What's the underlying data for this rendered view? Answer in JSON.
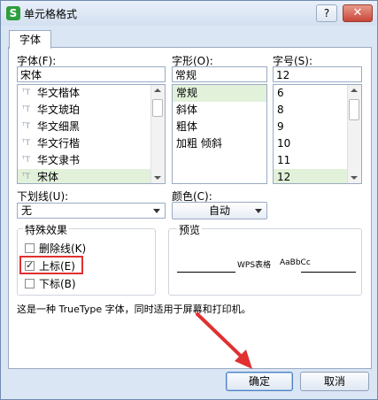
{
  "window": {
    "title": "单元格格式",
    "app_icon": "S",
    "help": "?",
    "close": "✕"
  },
  "tabs": [
    "字体"
  ],
  "font": {
    "label": "字体(F):",
    "value": "宋体",
    "items": [
      "华文楷体",
      "华文琥珀",
      "华文细黑",
      "华文行楷",
      "华文隶书",
      "宋体"
    ],
    "selected": "宋体"
  },
  "style": {
    "label": "字形(O):",
    "value": "常规",
    "items": [
      "常规",
      "斜体",
      "粗体",
      "加粗 倾斜"
    ],
    "selected": "常规"
  },
  "size": {
    "label": "字号(S):",
    "value": "12",
    "items": [
      "6",
      "8",
      "9",
      "10",
      "11",
      "12"
    ],
    "selected": "12"
  },
  "underline": {
    "label": "下划线(U):",
    "value": "无"
  },
  "color": {
    "label": "颜色(C):",
    "value": "自动"
  },
  "effects": {
    "label": "特殊效果",
    "strikethrough": {
      "label": "删除线(K)",
      "checked": false
    },
    "superscript": {
      "label": "上标(E)",
      "checked": true
    },
    "subscript": {
      "label": "下标(B)",
      "checked": false
    }
  },
  "preview": {
    "label": "预览",
    "sample1": "WPS表格",
    "sample2": "AaBbCc"
  },
  "note": "这是一种 TrueType 字体，同时适用于屏幕和打印机。",
  "buttons": {
    "ok": "确定",
    "cancel": "取消"
  },
  "colors": {
    "selection": "#e2f1da",
    "highlight_box": "#e03030",
    "arrow": "#e03030"
  }
}
